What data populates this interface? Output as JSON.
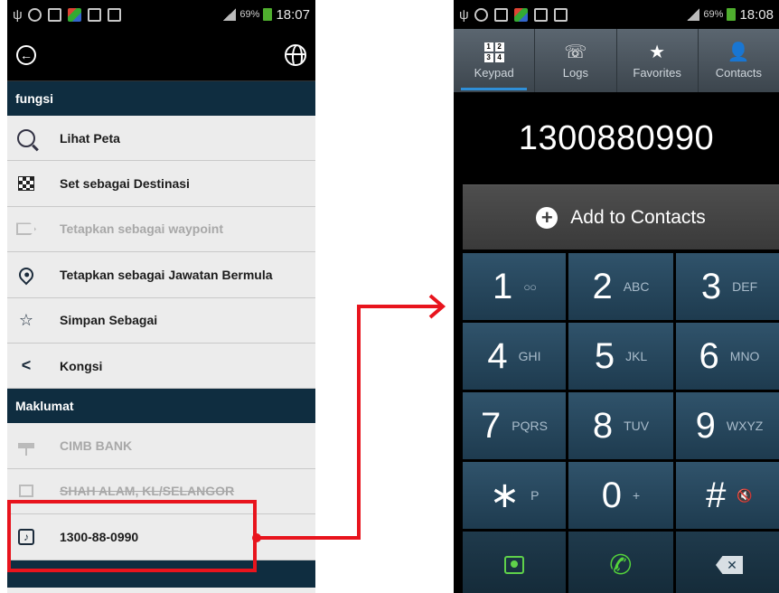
{
  "left": {
    "status": {
      "battery": "69%",
      "time": "18:07"
    },
    "appbar": {
      "back_icon": "back-circle-icon",
      "globe_icon": "globe-icon"
    },
    "section_functions": "fungsi",
    "function_items": [
      {
        "label": "Lihat Peta",
        "icon": "map-search-icon",
        "enabled": true
      },
      {
        "label": "Set sebagai Destinasi",
        "icon": "checkered-flag-icon",
        "enabled": true
      },
      {
        "label": "Tetapkan sebagai waypoint",
        "icon": "waypoint-icon",
        "enabled": false
      },
      {
        "label": "Tetapkan sebagai Jawatan Bermula",
        "icon": "location-pin-icon",
        "enabled": true
      },
      {
        "label": "Simpan Sebagai",
        "icon": "star-save-icon",
        "enabled": true
      },
      {
        "label": "Kongsi",
        "icon": "share-icon",
        "enabled": true
      }
    ],
    "section_info": "Maklumat",
    "info_items": [
      {
        "label": "CIMB BANK",
        "icon": "signpost-icon",
        "enabled": false
      },
      {
        "label": "SHAH ALAM, KL/SELANGOR",
        "icon": "home-icon",
        "enabled": false
      },
      {
        "label": "1300-88-0990",
        "icon": "phone-icon",
        "enabled": true
      }
    ]
  },
  "right": {
    "status": {
      "battery": "69%",
      "time": "18:08"
    },
    "tabs": [
      {
        "label": "Keypad",
        "icon": "keypad-icon",
        "active": true
      },
      {
        "label": "Logs",
        "icon": "call-logs-icon",
        "active": false
      },
      {
        "label": "Favorites",
        "icon": "star-icon",
        "active": false
      },
      {
        "label": "Contacts",
        "icon": "person-icon",
        "active": false
      }
    ],
    "dialed_number": "1300880990",
    "add_to_contacts": "Add to Contacts",
    "keys": [
      {
        "digit": "1",
        "letters": "○○"
      },
      {
        "digit": "2",
        "letters": "ABC"
      },
      {
        "digit": "3",
        "letters": "DEF"
      },
      {
        "digit": "4",
        "letters": "GHI"
      },
      {
        "digit": "5",
        "letters": "JKL"
      },
      {
        "digit": "6",
        "letters": "MNO"
      },
      {
        "digit": "7",
        "letters": "PQRS"
      },
      {
        "digit": "8",
        "letters": "TUV"
      },
      {
        "digit": "9",
        "letters": "WXYZ"
      },
      {
        "digit": "∗",
        "letters": "P"
      },
      {
        "digit": "0",
        "letters": "+"
      },
      {
        "digit": "#",
        "letters": "🔇"
      }
    ],
    "actions": [
      {
        "name": "add-contact-action",
        "icon": "contact-card-icon"
      },
      {
        "name": "call-action",
        "icon": "phone-call-icon"
      },
      {
        "name": "backspace-action",
        "icon": "backspace-icon"
      }
    ]
  },
  "annotation": {
    "color": "#e8141d"
  }
}
